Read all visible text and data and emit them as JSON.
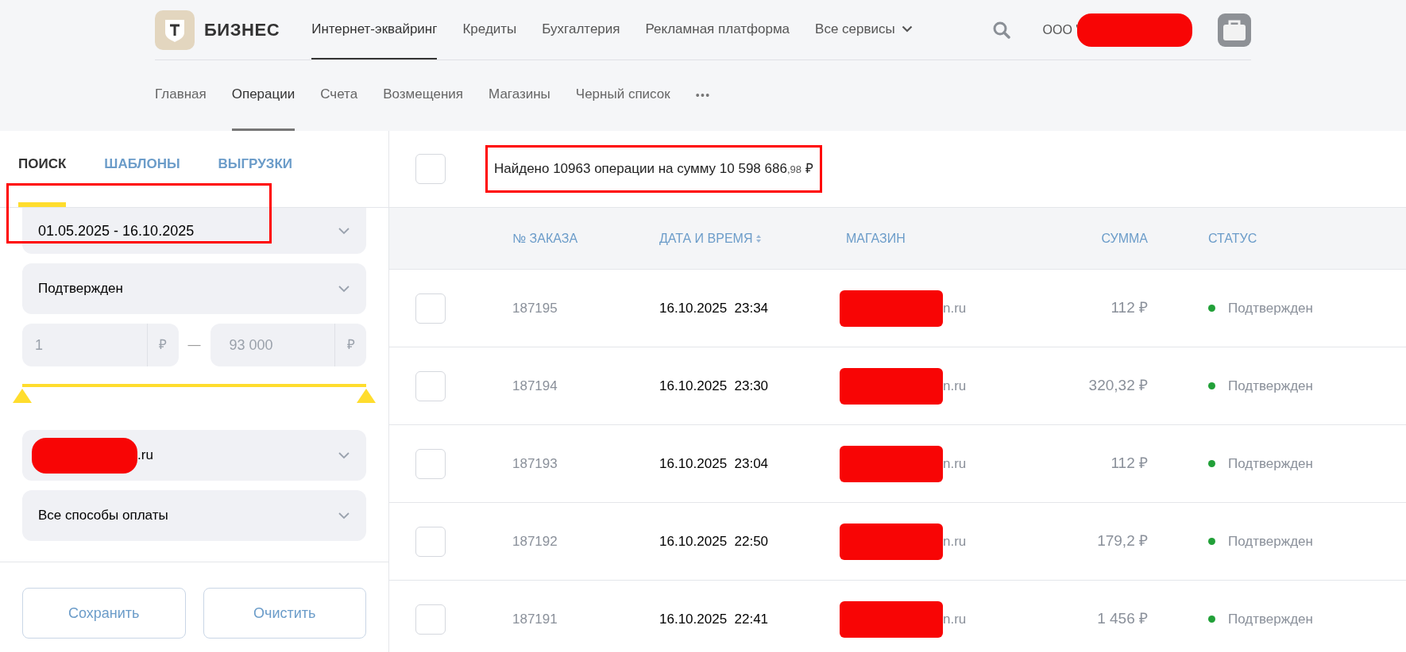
{
  "header": {
    "logo_text": "БИЗНЕС",
    "nav": [
      {
        "label": "Интернет-эквайринг",
        "selected": true,
        "kind": "link"
      },
      {
        "label": "Кредиты",
        "selected": false,
        "kind": "link"
      },
      {
        "label": "Бухгалтерия",
        "selected": false,
        "kind": "link"
      },
      {
        "label": "Рекламная платформа",
        "selected": false,
        "kind": "link"
      },
      {
        "label": "Все сервисы",
        "selected": false,
        "kind": "dropdown"
      }
    ],
    "company": "ООО \""
  },
  "subnav": {
    "items": [
      {
        "label": "Главная",
        "selected": false
      },
      {
        "label": "Операции",
        "selected": true
      },
      {
        "label": "Счета",
        "selected": false
      },
      {
        "label": "Возмещения",
        "selected": false
      },
      {
        "label": "Магазины",
        "selected": false
      },
      {
        "label": "Черный список",
        "selected": false
      }
    ],
    "more": "•••"
  },
  "sidebar": {
    "tabs": [
      {
        "label": "ПОИСК",
        "selected": true
      },
      {
        "label": "ШАБЛОНЫ",
        "selected": false
      },
      {
        "label": "ВЫГРУЗКИ",
        "selected": false
      }
    ],
    "date_range": "01.05.2025 - 16.10.2025",
    "status": "Подтвержден",
    "amount": {
      "from": "1",
      "to": "93 000",
      "currency": "₽",
      "separator": "—"
    },
    "slider": {
      "level": 1
    },
    "store": ".ru",
    "payment": "Все способы оплаты",
    "buttons": [
      "Сохранить",
      "Очистить"
    ]
  },
  "summary": {
    "checked": false,
    "text": "Найдено 10963 операции на сумму 10 598 686",
    "cents": ",98",
    "currency": "₽"
  },
  "table": {
    "columns": [
      {
        "label": "№ ЗАКАЗА",
        "sortable": false
      },
      {
        "label": "ДАТА И ВРЕМЯ",
        "sortable": true
      },
      {
        "label": "МАГАЗИН",
        "sortable": false
      },
      {
        "label": "СУММА",
        "sortable": false
      },
      {
        "label": "СТАТУС",
        "sortable": false
      }
    ],
    "rows": [
      {
        "checked": false,
        "order": "187195",
        "date": "16.10.2025",
        "time": "23:34",
        "store": "n.ru",
        "sum": "112 ₽",
        "status": "Подтвержден",
        "color": "#21a038"
      },
      {
        "checked": false,
        "order": "187194",
        "date": "16.10.2025",
        "time": "23:30",
        "store": "n.ru",
        "sum": "320,32 ₽",
        "status": "Подтвержден",
        "color": "#21a038"
      },
      {
        "checked": false,
        "order": "187193",
        "date": "16.10.2025",
        "time": "23:04",
        "store": "n.ru",
        "sum": "112 ₽",
        "status": "Подтвержден",
        "color": "#21a038"
      },
      {
        "checked": false,
        "order": "187192",
        "date": "16.10.2025",
        "time": "22:50",
        "store": "n.ru",
        "sum": "179,2 ₽",
        "status": "Подтвержден",
        "color": "#21a038"
      },
      {
        "checked": false,
        "order": "187191",
        "date": "16.10.2025",
        "time": "22:41",
        "store": "n.ru",
        "sum": "1 456 ₽",
        "status": "Подтвержден",
        "color": "#21a038"
      }
    ]
  }
}
